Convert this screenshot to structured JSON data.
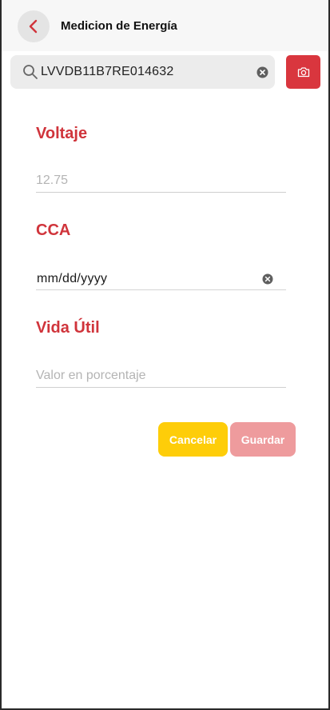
{
  "header": {
    "title": "Medicion de Energía"
  },
  "search": {
    "value": "LVVDB11B7RE014632"
  },
  "fields": {
    "voltaje": {
      "label": "Voltaje",
      "placeholder": "12.75"
    },
    "cca": {
      "label": "CCA",
      "value": "mm/dd/yyyy"
    },
    "vida_util": {
      "label": "Vida Útil",
      "placeholder": "Valor en porcentaje"
    }
  },
  "actions": {
    "cancel_label": "Cancelar",
    "save_label": "Guardar"
  },
  "colors": {
    "accent_red": "#d0343b",
    "cancel_yellow": "#fecd09",
    "save_disabled": "#ee9b9d"
  },
  "icons": {
    "back": "chevron-left-icon",
    "search": "search-icon",
    "clear": "clear-circle-icon",
    "camera": "camera-icon"
  }
}
